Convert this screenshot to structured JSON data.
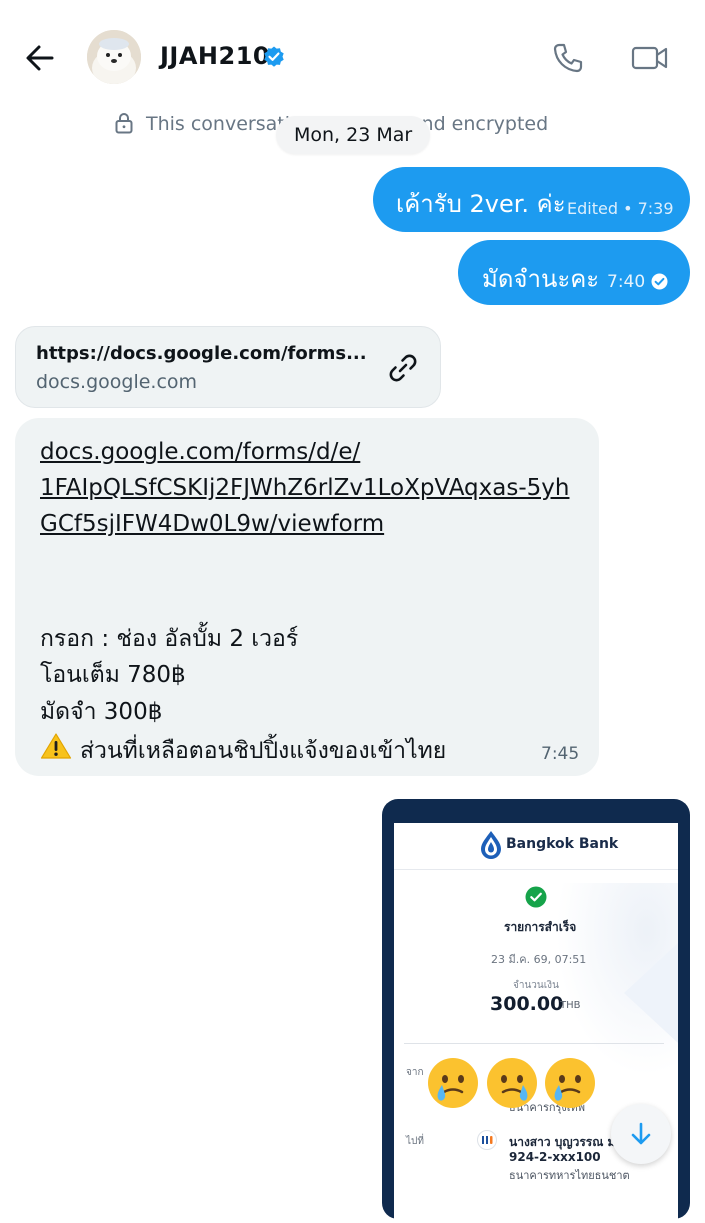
{
  "header": {
    "contact_name": "JJAH210",
    "icons": [
      "back-arrow-icon",
      "avatar",
      "verified-badge-icon",
      "phone-icon",
      "video-icon"
    ]
  },
  "encryption_notice": "This conversation is end-to-end encrypted",
  "date_chip": "Mon, 23 Mar",
  "messages": {
    "m1": {
      "text": "เค้ารับ 2ver. ค่ะ",
      "meta": "Edited • 7:39"
    },
    "m2": {
      "text": "มัดจำนะคะ",
      "time": "7:40"
    },
    "link_card": {
      "title": "https://docs.google.com/forms...",
      "domain": "docs.google.com"
    },
    "m3": {
      "url_lines": [
        "docs.google.com/forms/d/e/",
        "1FAIpQLSfCSKIj2FJWhZ6rlZv1LoXpVAqxas-5yh",
        "GCf5sjIFW4Dw0L9w/viewform"
      ],
      "lines": [
        "กรอก : ช่อง อัลบั้ม 2 เวอร์",
        "โอนเต็ม 780฿",
        "มัดจำ 300฿",
        "ส่วนที่เหลือตอนชิปปิ้งแจ้งของเข้าไทย"
      ],
      "time": "7:45"
    }
  },
  "receipt": {
    "bank_name": "Bangkok Bank",
    "status": "รายการสำเร็จ",
    "date": "23 มี.ค. 69, 07:51",
    "amount_label": "จำนวนเงิน",
    "amount": "300.00",
    "currency": "THB",
    "from_label": "จาก",
    "from_bank": "ธนาคารกรุงเทพ",
    "to_label": "ไปที่",
    "to_name": "นางสาว บุญวรรณ มา",
    "to_account": "924-2-xxx100",
    "to_bank": "ธนาคารทหารไทยธนชาต"
  },
  "colors": {
    "accent": "#1d9bf0",
    "incoming_bg": "#eff3f4",
    "text": "#0f1419",
    "muted": "#536471"
  }
}
